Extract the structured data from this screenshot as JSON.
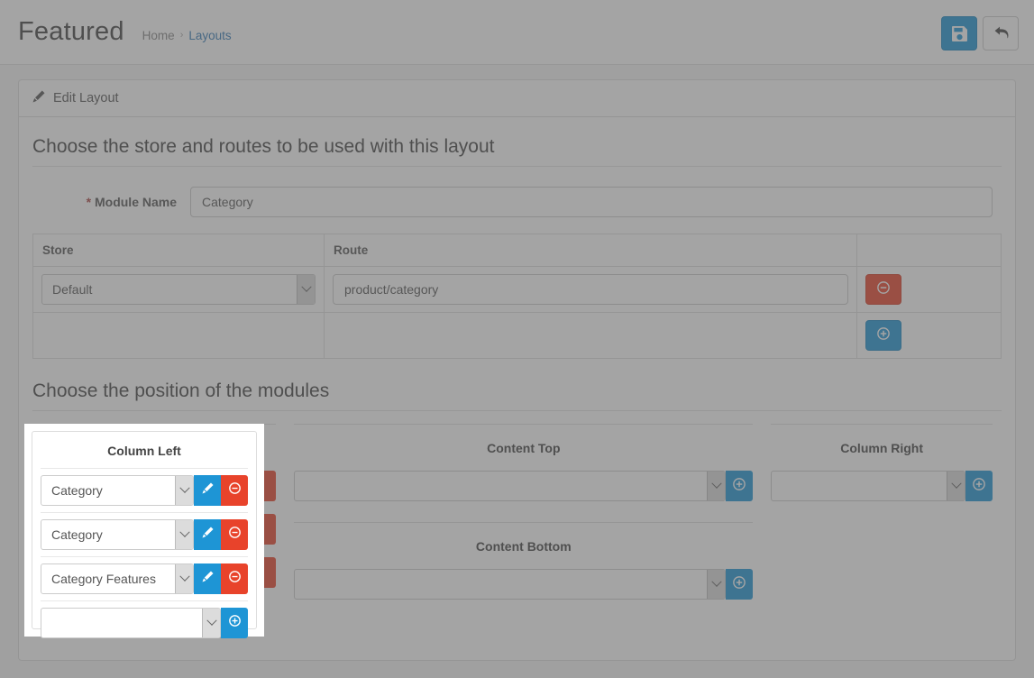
{
  "header": {
    "title": "Featured",
    "breadcrumb": [
      {
        "label": "Home",
        "active": false
      },
      {
        "label": "Layouts",
        "active": true
      }
    ],
    "separator": "›",
    "save_label": "Save",
    "back_label": "Back",
    "save_icon": "floppy-disk-icon",
    "back_icon": "reply-arrow-icon"
  },
  "panel": {
    "heading": "Edit Layout",
    "heading_icon": "pencil-icon"
  },
  "store_section": {
    "legend": "Choose the store and routes to be used with this layout",
    "module_name_label": "Module Name",
    "module_name_required_marker": "*",
    "module_name_value": "Category",
    "module_name_placeholder": "Module Name",
    "table": {
      "headers": [
        "Store",
        "Route",
        ""
      ],
      "rows": [
        {
          "store": "Default",
          "route": "product/category",
          "route_placeholder": "Route",
          "remove_label": "Remove",
          "remove_icon": "minus-circle-icon"
        }
      ],
      "add_label": "Add Route",
      "add_icon": "plus-circle-icon"
    }
  },
  "position_section": {
    "legend": "Choose the position of the modules",
    "columns": [
      {
        "key": "column_left",
        "title": "Column Left",
        "highlighted": true,
        "modules": [
          {
            "value": "Category",
            "edit_icon": "pencil-icon",
            "remove_icon": "minus-circle-icon",
            "edit_label": "Edit",
            "remove_label": "Remove"
          },
          {
            "value": "Category",
            "edit_icon": "pencil-icon",
            "remove_icon": "minus-circle-icon",
            "edit_label": "Edit",
            "remove_label": "Remove"
          },
          {
            "value": "Category Features",
            "edit_icon": "pencil-icon",
            "remove_icon": "minus-circle-icon",
            "edit_label": "Edit",
            "remove_label": "Remove"
          }
        ],
        "add_row": {
          "value": "",
          "add_icon": "plus-circle-icon",
          "add_label": "Add Module"
        }
      },
      {
        "key": "content_top",
        "title": "Content Top",
        "highlighted": false,
        "modules": [],
        "add_row": {
          "value": "",
          "add_icon": "plus-circle-icon",
          "add_label": "Add Module"
        }
      },
      {
        "key": "content_bottom",
        "title": "Content Bottom",
        "highlighted": false,
        "modules": [],
        "add_row": {
          "value": "",
          "add_icon": "plus-circle-icon",
          "add_label": "Add Module"
        }
      },
      {
        "key": "column_right",
        "title": "Column Right",
        "highlighted": false,
        "modules": [],
        "add_row": {
          "value": "",
          "add_icon": "plus-circle-icon",
          "add_label": "Add Module"
        }
      }
    ]
  },
  "colors": {
    "primary": "#1e95d5",
    "danger": "#e8432b",
    "link": "#337ab7",
    "required": "#a94442",
    "page_bg": "#f5f5f5"
  }
}
